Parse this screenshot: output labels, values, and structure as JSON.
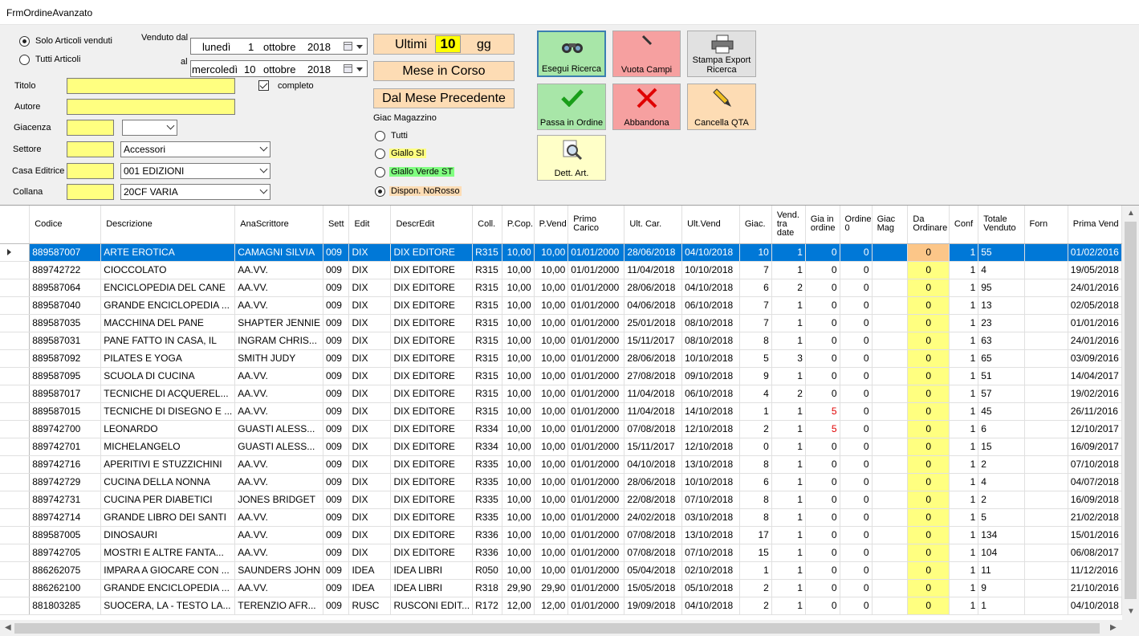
{
  "window": {
    "title": "FrmOrdineAvanzato"
  },
  "filters": {
    "radio_venduti": "Solo Articoli venduti",
    "radio_tutti": "Tutti Articoli",
    "venduto_dal_label": "Venduto dal",
    "al_label": "al",
    "date_from": {
      "weekday": "lunedì",
      "day": "1",
      "month": "ottobre",
      "year": "2018"
    },
    "date_to": {
      "weekday": "mercoledì",
      "day": "10",
      "month": "ottobre",
      "year": "2018"
    },
    "titolo_label": "Titolo",
    "titolo_value": "",
    "completo_label": "completo",
    "autore_label": "Autore",
    "autore_value": "",
    "giacenza_label": "Giacenza",
    "giacenza_value": "",
    "giacenza_op": "",
    "settore_label": "Settore",
    "settore_code": "",
    "settore_value": "Accessori",
    "casa_label": "Casa Editrice",
    "casa_code": "",
    "casa_value": "001 EDIZIONI",
    "collana_label": "Collana",
    "collana_code": "",
    "collana_value": "20CF VARIA"
  },
  "period": {
    "ultimi_label": "Ultimi",
    "ultimi_value": "10",
    "gg_label": "gg",
    "mese_corso": "Mese in Corso",
    "mese_precedente": "Dal Mese Precedente"
  },
  "giac_magazzino": {
    "label": "Giac Magazzino",
    "options": [
      "Tutti",
      "Giallo SI",
      "Giallo Verde ST",
      "Dispon. NoRosso"
    ],
    "selected": 3
  },
  "buttons": {
    "esegui": "Esegui Ricerca",
    "vuota": "Vuota Campi",
    "stampa": "Stampa Export Ricerca",
    "passa": "Passa in Ordine",
    "abbandona": "Abbandona",
    "cancella": "Cancella QTA",
    "dett": "Dett. Art."
  },
  "colors": {
    "accent_yellow": "#ffff80",
    "peach": "#fddcb4",
    "green_button": "#a8e6a8",
    "red_button": "#f6a0a0",
    "selection": "#0078d7"
  },
  "grid": {
    "columns": [
      "Codice",
      "Descrizione",
      "AnaScrittore",
      "Sett",
      "Edit",
      "DescrEdit",
      "Coll.",
      "P.Cop.",
      "P.Vend",
      "Primo Carico",
      "Ult. Car.",
      "Ult.Vend",
      "Giac.",
      "Vend. tra date",
      "Gia in ordine",
      "Ordine 0",
      "Giac Mag",
      "Da Ordinare",
      "Conf",
      "Totale Venduto",
      "Forn",
      "Prima Vend"
    ],
    "rows": [
      [
        "889587007",
        "ARTE EROTICA",
        "CAMAGNI SILVIA",
        "009",
        "DIX",
        "DIX EDITORE",
        "R315",
        "10,00",
        "10,00",
        "01/01/2000",
        "28/06/2018",
        "04/10/2018",
        "10",
        "1",
        "0",
        "0",
        "",
        "0",
        "1",
        "55",
        "",
        "01/02/2016"
      ],
      [
        "889742722",
        "CIOCCOLATO",
        "AA.VV.",
        "009",
        "DIX",
        "DIX EDITORE",
        "R315",
        "10,00",
        "10,00",
        "01/01/2000",
        "11/04/2018",
        "10/10/2018",
        "7",
        "1",
        "0",
        "0",
        "",
        "0",
        "1",
        "4",
        "",
        "19/05/2018"
      ],
      [
        "889587064",
        "ENCICLOPEDIA DEL CANE",
        "AA.VV.",
        "009",
        "DIX",
        "DIX EDITORE",
        "R315",
        "10,00",
        "10,00",
        "01/01/2000",
        "28/06/2018",
        "04/10/2018",
        "6",
        "2",
        "0",
        "0",
        "",
        "0",
        "1",
        "95",
        "",
        "24/01/2016"
      ],
      [
        "889587040",
        "GRANDE ENCICLOPEDIA ...",
        "AA.VV.",
        "009",
        "DIX",
        "DIX EDITORE",
        "R315",
        "10,00",
        "10,00",
        "01/01/2000",
        "04/06/2018",
        "06/10/2018",
        "7",
        "1",
        "0",
        "0",
        "",
        "0",
        "1",
        "13",
        "",
        "02/05/2018"
      ],
      [
        "889587035",
        "MACCHINA DEL PANE",
        "SHAPTER JENNIE",
        "009",
        "DIX",
        "DIX EDITORE",
        "R315",
        "10,00",
        "10,00",
        "01/01/2000",
        "25/01/2018",
        "08/10/2018",
        "7",
        "1",
        "0",
        "0",
        "",
        "0",
        "1",
        "23",
        "",
        "01/01/2016"
      ],
      [
        "889587031",
        "PANE FATTO IN CASA, IL",
        "INGRAM CHRIS...",
        "009",
        "DIX",
        "DIX EDITORE",
        "R315",
        "10,00",
        "10,00",
        "01/01/2000",
        "15/11/2017",
        "08/10/2018",
        "8",
        "1",
        "0",
        "0",
        "",
        "0",
        "1",
        "63",
        "",
        "24/01/2016"
      ],
      [
        "889587092",
        "PILATES E YOGA",
        "SMITH JUDY",
        "009",
        "DIX",
        "DIX EDITORE",
        "R315",
        "10,00",
        "10,00",
        "01/01/2000",
        "28/06/2018",
        "10/10/2018",
        "5",
        "3",
        "0",
        "0",
        "",
        "0",
        "1",
        "65",
        "",
        "03/09/2016"
      ],
      [
        "889587095",
        "SCUOLA DI CUCINA",
        "AA.VV.",
        "009",
        "DIX",
        "DIX EDITORE",
        "R315",
        "10,00",
        "10,00",
        "01/01/2000",
        "27/08/2018",
        "09/10/2018",
        "9",
        "1",
        "0",
        "0",
        "",
        "0",
        "1",
        "51",
        "",
        "14/04/2017"
      ],
      [
        "889587017",
        "TECNICHE DI ACQUEREL...",
        "AA.VV.",
        "009",
        "DIX",
        "DIX EDITORE",
        "R315",
        "10,00",
        "10,00",
        "01/01/2000",
        "11/04/2018",
        "06/10/2018",
        "4",
        "2",
        "0",
        "0",
        "",
        "0",
        "1",
        "57",
        "",
        "19/02/2016"
      ],
      [
        "889587015",
        "TECNICHE DI DISEGNO E ...",
        "AA.VV.",
        "009",
        "DIX",
        "DIX EDITORE",
        "R315",
        "10,00",
        "10,00",
        "01/01/2000",
        "11/04/2018",
        "14/10/2018",
        "1",
        "1",
        "5",
        "0",
        "",
        "0",
        "1",
        "45",
        "",
        "26/11/2016"
      ],
      [
        "889742700",
        "LEONARDO",
        "GUASTI ALESS...",
        "009",
        "DIX",
        "DIX EDITORE",
        "R334",
        "10,00",
        "10,00",
        "01/01/2000",
        "07/08/2018",
        "12/10/2018",
        "2",
        "1",
        "5",
        "0",
        "",
        "0",
        "1",
        "6",
        "",
        "12/10/2017"
      ],
      [
        "889742701",
        "MICHELANGELO",
        "GUASTI ALESS...",
        "009",
        "DIX",
        "DIX EDITORE",
        "R334",
        "10,00",
        "10,00",
        "01/01/2000",
        "15/11/2017",
        "12/10/2018",
        "0",
        "1",
        "0",
        "0",
        "",
        "0",
        "1",
        "15",
        "",
        "16/09/2017"
      ],
      [
        "889742716",
        "APERITIVI E STUZZICHINI",
        "AA.VV.",
        "009",
        "DIX",
        "DIX EDITORE",
        "R335",
        "10,00",
        "10,00",
        "01/01/2000",
        "04/10/2018",
        "13/10/2018",
        "8",
        "1",
        "0",
        "0",
        "",
        "0",
        "1",
        "2",
        "",
        "07/10/2018"
      ],
      [
        "889742729",
        "CUCINA DELLA NONNA",
        "AA.VV.",
        "009",
        "DIX",
        "DIX EDITORE",
        "R335",
        "10,00",
        "10,00",
        "01/01/2000",
        "28/06/2018",
        "10/10/2018",
        "6",
        "1",
        "0",
        "0",
        "",
        "0",
        "1",
        "4",
        "",
        "04/07/2018"
      ],
      [
        "889742731",
        "CUCINA PER DIABETICI",
        "JONES BRIDGET",
        "009",
        "DIX",
        "DIX EDITORE",
        "R335",
        "10,00",
        "10,00",
        "01/01/2000",
        "22/08/2018",
        "07/10/2018",
        "8",
        "1",
        "0",
        "0",
        "",
        "0",
        "1",
        "2",
        "",
        "16/09/2018"
      ],
      [
        "889742714",
        "GRANDE LIBRO DEI SANTI",
        "AA.VV.",
        "009",
        "DIX",
        "DIX EDITORE",
        "R335",
        "10,00",
        "10,00",
        "01/01/2000",
        "24/02/2018",
        "03/10/2018",
        "8",
        "1",
        "0",
        "0",
        "",
        "0",
        "1",
        "5",
        "",
        "21/02/2018"
      ],
      [
        "889587005",
        "DINOSAURI",
        "AA.VV.",
        "009",
        "DIX",
        "DIX EDITORE",
        "R336",
        "10,00",
        "10,00",
        "01/01/2000",
        "07/08/2018",
        "13/10/2018",
        "17",
        "1",
        "0",
        "0",
        "",
        "0",
        "1",
        "134",
        "",
        "15/01/2016"
      ],
      [
        "889742705",
        "MOSTRI E ALTRE FANTA...",
        "AA.VV.",
        "009",
        "DIX",
        "DIX EDITORE",
        "R336",
        "10,00",
        "10,00",
        "01/01/2000",
        "07/08/2018",
        "07/10/2018",
        "15",
        "1",
        "0",
        "0",
        "",
        "0",
        "1",
        "104",
        "",
        "06/08/2017"
      ],
      [
        "886262075",
        "IMPARA A GIOCARE CON ...",
        "SAUNDERS JOHN",
        "009",
        "IDEA",
        "IDEA LIBRI",
        "R050",
        "10,00",
        "10,00",
        "01/01/2000",
        "05/04/2018",
        "02/10/2018",
        "1",
        "1",
        "0",
        "0",
        "",
        "0",
        "1",
        "11",
        "",
        "11/12/2016"
      ],
      [
        "886262100",
        "GRANDE ENCICLOPEDIA ...",
        "AA.VV.",
        "009",
        "IDEA",
        "IDEA LIBRI",
        "R318",
        "29,90",
        "29,90",
        "01/01/2000",
        "15/05/2018",
        "05/10/2018",
        "2",
        "1",
        "0",
        "0",
        "",
        "0",
        "1",
        "9",
        "",
        "21/10/2016"
      ],
      [
        "881803285",
        "SUOCERA, LA - TESTO LA...",
        "TERENZIO AFR...",
        "009",
        "RUSC",
        "RUSCONI EDIT...",
        "R172",
        "12,00",
        "12,00",
        "01/01/2000",
        "19/09/2018",
        "04/10/2018",
        "2",
        "1",
        "0",
        "0",
        "",
        "0",
        "1",
        "1",
        "",
        "04/10/2018"
      ]
    ],
    "selected_row": 0,
    "red_cells": [
      [
        9,
        14
      ],
      [
        10,
        14
      ]
    ]
  }
}
